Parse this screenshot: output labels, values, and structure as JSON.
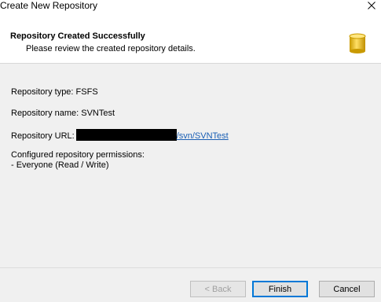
{
  "window": {
    "title": "Create New Repository"
  },
  "header": {
    "title": "Repository Created Successfully",
    "subtitle": "Please review the created repository details.",
    "icon": "database-icon"
  },
  "details": {
    "type_label": "Repository type: FSFS",
    "name_label": "Repository name: SVNTest",
    "url_label": "Repository URL:",
    "url_visible": "/svn/SVNTest",
    "permissions_label": "Configured repository permissions:",
    "permissions_entry": "- Everyone (Read / Write)"
  },
  "buttons": {
    "back": "< Back",
    "finish": "Finish",
    "cancel": "Cancel"
  },
  "colors": {
    "accent": "#0078d7",
    "link": "#1a5fb4",
    "icon_gold": "#e8b800"
  }
}
